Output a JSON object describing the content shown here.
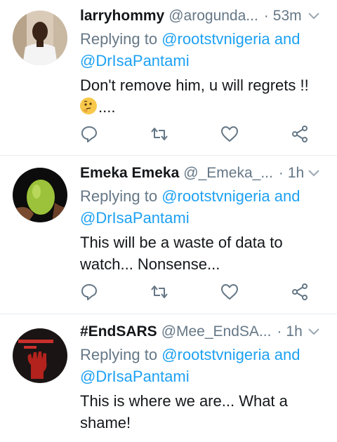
{
  "tweets": [
    {
      "name": "larryhommy",
      "handle": "@arogunda...",
      "dot": "·",
      "time": "53m",
      "reply_prefix": "Replying to",
      "reply_user1": "@rootstvnigeria",
      "reply_and": "and",
      "reply_user2": "@DrIsaPantami",
      "text_line1": "Don't remove him, u will regrets !!",
      "text_line2": "....",
      "emoji": "thinking-face",
      "avatar": "man-in-white-shirt"
    },
    {
      "name": "Emeka Emeka",
      "handle": "@_Emeka_...",
      "dot": "·",
      "time": "1h",
      "reply_prefix": "Replying to",
      "reply_user1": "@rootstvnigeria",
      "reply_and": "and",
      "reply_user2": "@DrIsaPantami",
      "text_line1": "This will be a waste of data to",
      "text_line2": "watch... Nonsense...",
      "avatar": "green-fruit-in-hand"
    },
    {
      "name": "#EndSARS",
      "handle": "@Mee_EndSA...",
      "dot": "·",
      "time": "1h",
      "reply_prefix": "Replying to",
      "reply_user1": "@rootstvnigeria",
      "reply_and": "and",
      "reply_user2": "@DrIsaPantami",
      "text_line1": "This is where we are... What a",
      "text_line2": "shame!",
      "avatar": "raised-fist-endsars"
    }
  ],
  "icons": [
    "reply-icon",
    "retweet-icon",
    "like-icon",
    "share-icon",
    "chevron-down-icon"
  ],
  "colors": {
    "link": "#1da1f2",
    "secondary": "#657786",
    "text": "#14171a",
    "divider": "#e6ecf0"
  }
}
